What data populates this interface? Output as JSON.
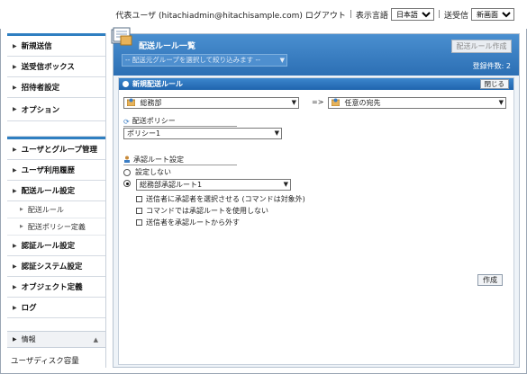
{
  "header": {
    "user_text": "代表ユーザ (hitachiadmin@hitachisample.com)",
    "logout": "ログアウト",
    "lang_label": "表示言語",
    "lang_value": "日本語",
    "send_receive_label": "送受信",
    "send_receive_value": "新画面"
  },
  "sidebar": {
    "items_top": [
      {
        "label": "新規送信"
      },
      {
        "label": "送受信ボックス"
      },
      {
        "label": "招待者設定"
      },
      {
        "label": "オプション"
      }
    ],
    "items_admin": [
      {
        "label": "ユーザとグループ管理"
      },
      {
        "label": "ユーザ利用履歴"
      },
      {
        "label": "配送ルール設定"
      }
    ],
    "sub_items": [
      {
        "label": "配送ルール"
      },
      {
        "label": "配送ポリシー定義"
      }
    ],
    "items_admin2": [
      {
        "label": "認証ルール設定"
      },
      {
        "label": "認証システム設定"
      },
      {
        "label": "オブジェクト定義"
      },
      {
        "label": "ログ"
      }
    ],
    "info_label": "情報",
    "info_body": "ユーザディスク容量"
  },
  "main": {
    "title": "配送ルール一覧",
    "filter_placeholder": "-- 配送元グループを選択して絞り込みます --",
    "create_top_label": "配送ルール作成",
    "count_text": "登録件数: 2",
    "editor": {
      "title": "新規配送ルール",
      "close_label": "閉じる",
      "from_value": "総務部",
      "arrow_text": "=>",
      "to_value": "任意の宛先",
      "policy_label": "配送ポリシー",
      "policy_value": "ポリシー1",
      "approval_label": "承認ルート設定",
      "radio_none": "設定しない",
      "route_value": "総務部承認ルート1",
      "check1": "送信者に承認者を選択させる (コマンドは対象外)",
      "check2": "コマンドでは承認ルートを使用しない",
      "check3": "送信者を承認ルートから外す",
      "create_label": "作成"
    }
  },
  "colors": {
    "accent_blue": "#2f7fc1",
    "header_gradient_top": "#4a8fd0",
    "panel_bg": "#eef3f8"
  }
}
